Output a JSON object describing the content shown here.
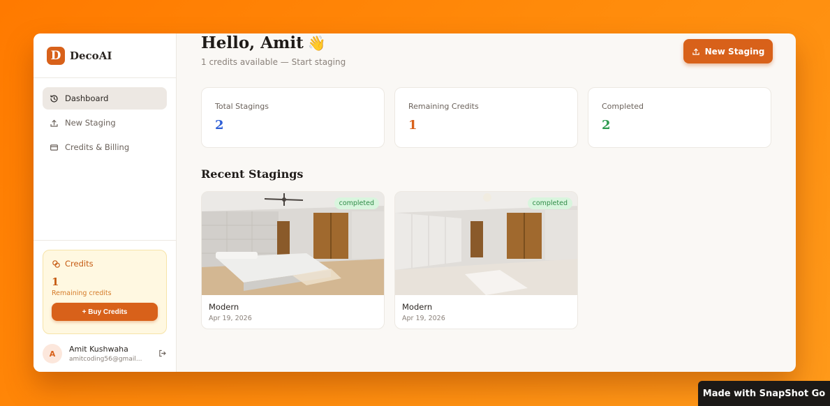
{
  "brand": {
    "logo_letter": "D",
    "name": "DecoAI"
  },
  "sidebar": {
    "items": [
      {
        "label": "Dashboard",
        "icon": "history-icon",
        "active": true
      },
      {
        "label": "New Staging",
        "icon": "upload-icon",
        "active": false
      },
      {
        "label": "Credits & Billing",
        "icon": "credit-card-icon",
        "active": false
      }
    ],
    "credits": {
      "title": "Credits",
      "value": "1",
      "subtitle": "Remaining credits",
      "buy_label": "+ Buy Credits"
    },
    "user": {
      "initial": "A",
      "name": "Amit Kushwaha",
      "email": "amitcoding56@gmail..."
    }
  },
  "header": {
    "greeting": "Hello, Amit",
    "wave": "👋",
    "subtitle": "1 credits available — Start staging",
    "new_staging_label": "New Staging"
  },
  "stats": [
    {
      "label": "Total Stagings",
      "value": "2",
      "color": "#2f5fd6"
    },
    {
      "label": "Remaining Credits",
      "value": "1",
      "color": "#d8611a"
    },
    {
      "label": "Completed",
      "value": "2",
      "color": "#2d9a4f"
    }
  ],
  "recent": {
    "title": "Recent Stagings",
    "items": [
      {
        "status": "completed",
        "style": "Modern",
        "date": "Apr 19, 2026"
      },
      {
        "status": "completed",
        "style": "Modern",
        "date": "Apr 19, 2026"
      }
    ]
  },
  "watermark": "Made with SnapShot Go",
  "colors": {
    "accent": "#d8611a",
    "background": "#ff8a0a"
  }
}
